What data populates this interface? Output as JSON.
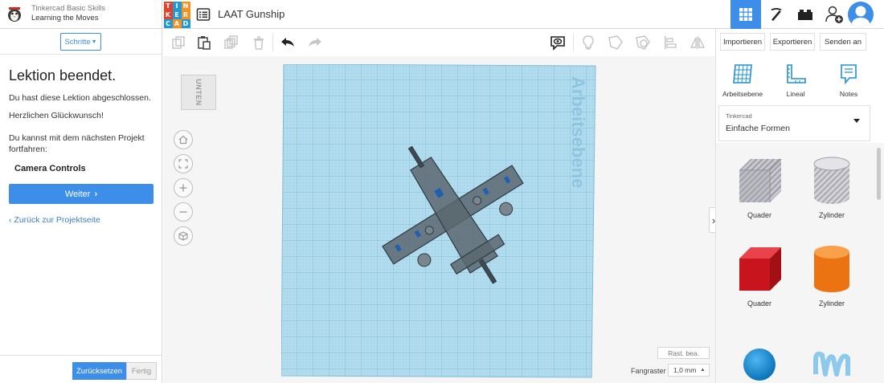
{
  "lesson": {
    "course": "Tinkercad Basic Skills",
    "name": "Learning the Moves"
  },
  "logo_letters": [
    "T",
    "I",
    "N",
    "K",
    "E",
    "R",
    "C",
    "A",
    "D"
  ],
  "logo_colors": [
    "#e2412d",
    "#1f9ad6",
    "#f69121",
    "#e2412d",
    "#1f9ad6",
    "#f69121",
    "#1f9ad6",
    "#f69121",
    "#1f9ad6"
  ],
  "design_title": "LAAT Gunship",
  "left": {
    "steps_label": "Schritte",
    "title": "Lektion beendet.",
    "complete": "Du hast diese Lektion abgeschlossen.",
    "congrats": "Herzlichen Glückwunsch!",
    "continue": "Du kannst mit dem nächsten Projekt fortfahren:",
    "next_project": "Camera Controls",
    "next_button": "Weiter",
    "back_link": "Zurück zur Projektseite",
    "reset_button": "Zurücksetzen",
    "finish_button": "Fertig"
  },
  "viewport": {
    "viewcube_label": "UNTEN",
    "workplane_label": "Arbeitsebene",
    "grid_edit": "Rast. bea.",
    "snap_label": "Fangraster",
    "snap_value": "1,0 mm"
  },
  "right": {
    "import_button": "Importieren",
    "export_button": "Exportieren",
    "send_button": "Senden an",
    "tools": [
      "Arbeitsebene",
      "Lineal",
      "Notes"
    ],
    "library_label": "Tinkercad",
    "library_value": "Einfache Formen",
    "shapes": [
      {
        "name": "Quader",
        "color": "#9a9aa2"
      },
      {
        "name": "Zylinder",
        "color": "#b7b7bd"
      },
      {
        "name": "Quader",
        "color": "#d91e25"
      },
      {
        "name": "Zylinder",
        "color": "#f07a14"
      }
    ]
  },
  "colors": {
    "accent": "#3d8ee8",
    "workplane": "#aad8ee"
  }
}
